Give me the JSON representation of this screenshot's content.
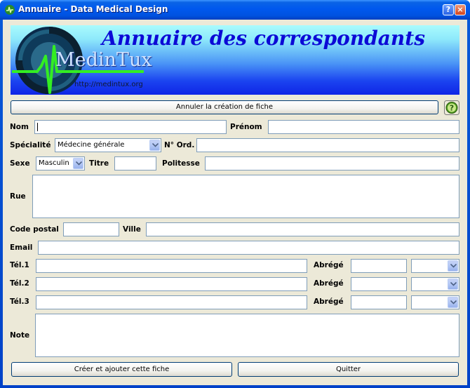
{
  "window": {
    "title": "Annuaire - Data Medical Design",
    "help_label": "?",
    "close_label": "×"
  },
  "banner": {
    "title": "Annuaire des correspondants",
    "logo_text": "MedinTux",
    "url": "http://medintux.org"
  },
  "top_bar": {
    "cancel_label": "Annuler la création de fiche"
  },
  "labels": {
    "nom": "Nom",
    "prenom": "Prénom",
    "specialite": "Spécialité",
    "n_ord": "N° Ord.",
    "sexe": "Sexe",
    "titre": "Titre",
    "politesse": "Politesse",
    "rue": "Rue",
    "code_postal": "Code postal",
    "ville": "Ville",
    "email": "Email",
    "tel1": "Tél.1",
    "tel2": "Tél.2",
    "tel3": "Tél.3",
    "abrege": "Abrégé",
    "note": "Note"
  },
  "values": {
    "specialite": "Médecine générale",
    "sexe": "Masculin"
  },
  "footer": {
    "create_label": "Créer et ajouter cette fiche",
    "quit_label": "Quitter"
  },
  "colors": {
    "titlebar": "#0054e3",
    "face": "#ece9d8",
    "field_border": "#7f9db9"
  }
}
